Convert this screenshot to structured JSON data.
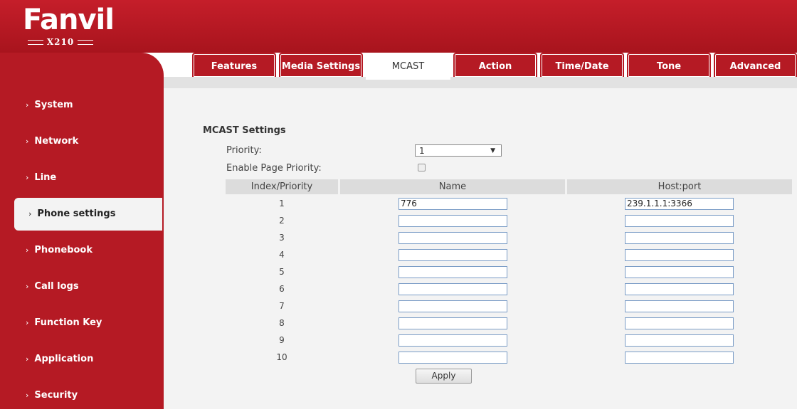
{
  "brand": {
    "logo_text": "Fanvil",
    "model": "X210"
  },
  "sidebar": {
    "items": [
      {
        "label": "System"
      },
      {
        "label": "Network"
      },
      {
        "label": "Line"
      },
      {
        "label": "Phone settings",
        "active": true
      },
      {
        "label": "Phonebook"
      },
      {
        "label": "Call logs"
      },
      {
        "label": "Function Key"
      },
      {
        "label": "Application"
      },
      {
        "label": "Security"
      }
    ]
  },
  "tabs": [
    {
      "label": "Features"
    },
    {
      "label": "Media Settings"
    },
    {
      "label": "MCAST",
      "active": true
    },
    {
      "label": "Action"
    },
    {
      "label": "Time/Date"
    },
    {
      "label": "Tone"
    },
    {
      "label": "Advanced"
    }
  ],
  "mcast": {
    "section_title": "MCAST Settings",
    "priority_label": "Priority:",
    "priority_value": "1",
    "enable_page_priority_label": "Enable Page Priority:",
    "enable_page_priority_checked": false,
    "columns": {
      "index": "Index/Priority",
      "name": "Name",
      "host": "Host:port"
    },
    "rows": [
      {
        "index": "1",
        "name": "776",
        "host": "239.1.1.1:3366"
      },
      {
        "index": "2",
        "name": "",
        "host": ""
      },
      {
        "index": "3",
        "name": "",
        "host": ""
      },
      {
        "index": "4",
        "name": "",
        "host": ""
      },
      {
        "index": "5",
        "name": "",
        "host": ""
      },
      {
        "index": "6",
        "name": "",
        "host": ""
      },
      {
        "index": "7",
        "name": "",
        "host": ""
      },
      {
        "index": "8",
        "name": "",
        "host": ""
      },
      {
        "index": "9",
        "name": "",
        "host": ""
      },
      {
        "index": "10",
        "name": "",
        "host": ""
      }
    ],
    "apply_label": "Apply"
  },
  "colors": {
    "brand_red": "#b51a24",
    "panel_bg": "#f3f3f3",
    "header_bg": "#dcdcdc"
  },
  "icons": {
    "nav_chevron": "chevron-right-icon",
    "select_arrow": "dropdown-arrow-icon"
  }
}
